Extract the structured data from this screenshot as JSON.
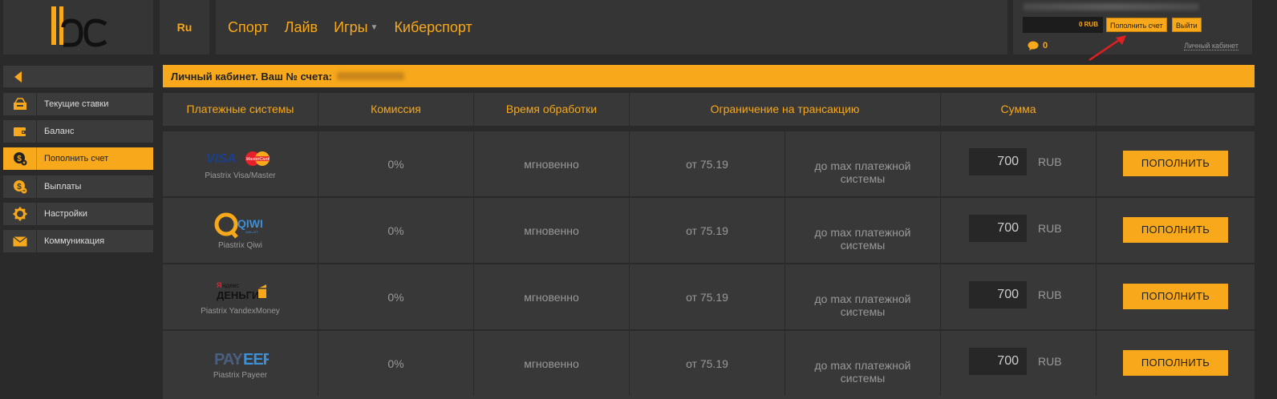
{
  "header": {
    "logo_text": "1bc",
    "lang": "Ru",
    "nav": [
      {
        "label": "Спорт"
      },
      {
        "label": "Лайв"
      },
      {
        "label": "Игры",
        "caret": "▼"
      },
      {
        "label": "Киберспорт"
      }
    ],
    "account": {
      "balance": "0 RUB",
      "deposit_label": "Пополнить счет",
      "logout_label": "Выйти",
      "messages_count": "0",
      "cabinet_link": "Личный кабинет"
    }
  },
  "sidebar": {
    "items": [
      {
        "label": "Текущие ставки",
        "icon": "bets-icon"
      },
      {
        "label": "Баланс",
        "icon": "wallet-icon"
      },
      {
        "label": "Пополнить счет",
        "icon": "deposit-icon",
        "active": true
      },
      {
        "label": "Выплаты",
        "icon": "payout-icon"
      },
      {
        "label": "Настройки",
        "icon": "gear-icon"
      },
      {
        "label": "Коммуникация",
        "icon": "envelope-icon"
      }
    ]
  },
  "main": {
    "banner_title": "Личный кабинет. Ваш № счета:",
    "columns": [
      "Платежные системы",
      "Комиссия",
      "Время обработки",
      "Ограничение на трансакцию",
      "Сумма"
    ],
    "rows": [
      {
        "logo": "visa-mastercard-logo",
        "system": "Piastrix Visa/Master",
        "commission": "0%",
        "time": "мгновенно",
        "min": "от 75.19",
        "max": "до max платежной системы",
        "amount": "700",
        "currency": "RUB",
        "button": "ПОПОЛНИТЬ"
      },
      {
        "logo": "qiwi-logo",
        "system": "Piastrix Qiwi",
        "commission": "0%",
        "time": "мгновенно",
        "min": "от 75.19",
        "max": "до max платежной системы",
        "amount": "700",
        "currency": "RUB",
        "button": "ПОПОЛНИТЬ"
      },
      {
        "logo": "yandex-money-logo",
        "system": "Piastrix YandexMoney",
        "commission": "0%",
        "time": "мгновенно",
        "min": "от 75.19",
        "max": "до max платежной системы",
        "amount": "700",
        "currency": "RUB",
        "button": "ПОПОЛНИТЬ"
      },
      {
        "logo": "payeer-logo",
        "system": "Piastrix Payeer",
        "commission": "0%",
        "time": "мгновенно",
        "min": "от 75.19",
        "max": "до max платежной системы",
        "amount": "700",
        "currency": "RUB",
        "button": "ПОПОЛНИТЬ"
      }
    ]
  },
  "colors": {
    "accent": "#f7a81b",
    "background": "#2a2a2a",
    "panel": "#383838",
    "annotation_arrow": "#e02020"
  }
}
